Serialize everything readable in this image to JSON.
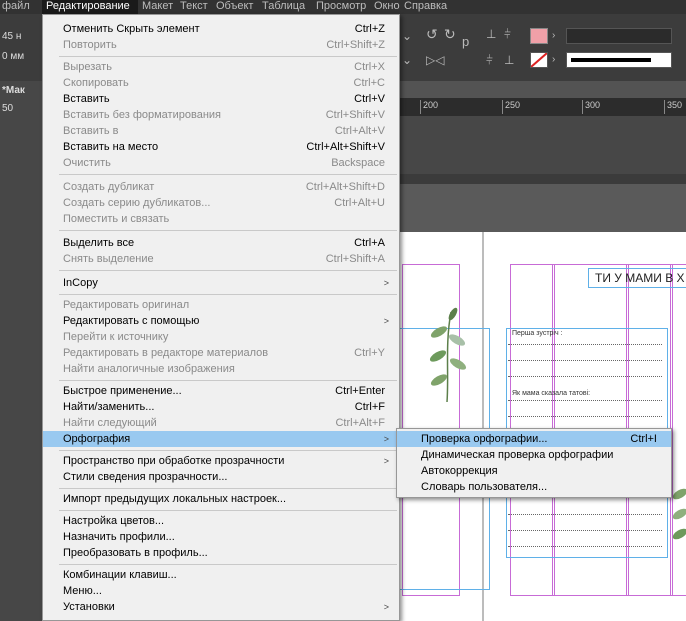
{
  "menubar": {
    "items": [
      "файл",
      "Редактирование",
      "Макет",
      "Текст",
      "Объект",
      "Таблица",
      "Просмотр",
      "Окно",
      "Справка"
    ]
  },
  "leftstrip": {
    "values": [
      "45 н",
      "0 мм",
      "*Мак",
      "50"
    ]
  },
  "ruler": {
    "ticks": [
      "200",
      "250",
      "300",
      "350"
    ]
  },
  "document": {
    "heading": "ТИ У МАМИ В Х",
    "line1": "Перша зустріч :",
    "line2": "Як мама сказала татові:"
  },
  "menu": {
    "items": [
      {
        "label": "Отменить Скрыть элемент",
        "shortcut": "Ctrl+Z"
      },
      {
        "label": "Повторить",
        "shortcut": "Ctrl+Shift+Z"
      },
      {
        "label": "Вырезать",
        "shortcut": "Ctrl+X"
      },
      {
        "label": "Скопировать",
        "shortcut": "Ctrl+C"
      },
      {
        "label": "Вставить",
        "shortcut": "Ctrl+V"
      },
      {
        "label": "Вставить без форматирования",
        "shortcut": "Ctrl+Shift+V"
      },
      {
        "label": "Вставить в",
        "shortcut": "Ctrl+Alt+V"
      },
      {
        "label": "Вставить на место",
        "shortcut": "Ctrl+Alt+Shift+V"
      },
      {
        "label": "Очистить",
        "shortcut": "Backspace"
      },
      {
        "label": "Создать дубликат",
        "shortcut": "Ctrl+Alt+Shift+D"
      },
      {
        "label": "Создать серию дубликатов...",
        "shortcut": "Ctrl+Alt+U"
      },
      {
        "label": "Поместить и связать",
        "shortcut": ""
      },
      {
        "label": "Выделить все",
        "shortcut": "Ctrl+A"
      },
      {
        "label": "Снять выделение",
        "shortcut": "Ctrl+Shift+A"
      },
      {
        "label": "InCopy",
        "shortcut": ""
      },
      {
        "label": "Редактировать оригинал",
        "shortcut": ""
      },
      {
        "label": "Редактировать с помощью",
        "shortcut": ""
      },
      {
        "label": "Перейти к источнику",
        "shortcut": ""
      },
      {
        "label": "Редактировать в редакторе материалов",
        "shortcut": "Ctrl+Y"
      },
      {
        "label": "Найти аналогичные изображения",
        "shortcut": ""
      },
      {
        "label": "Быстрое применение...",
        "shortcut": "Ctrl+Enter"
      },
      {
        "label": "Найти/заменить...",
        "shortcut": "Ctrl+F"
      },
      {
        "label": "Найти следующий",
        "shortcut": "Ctrl+Alt+F"
      },
      {
        "label": "Орфография",
        "shortcut": ""
      },
      {
        "label": "Пространство при обработке прозрачности",
        "shortcut": ""
      },
      {
        "label": "Стили сведения прозрачности...",
        "shortcut": ""
      },
      {
        "label": "Импорт предыдущих локальных настроек...",
        "shortcut": ""
      },
      {
        "label": "Настройка цветов...",
        "shortcut": ""
      },
      {
        "label": "Назначить профили...",
        "shortcut": ""
      },
      {
        "label": "Преобразовать в профиль...",
        "shortcut": ""
      },
      {
        "label": "Комбинации клавиш...",
        "shortcut": ""
      },
      {
        "label": "Меню...",
        "shortcut": ""
      },
      {
        "label": "Установки",
        "shortcut": ""
      }
    ]
  },
  "submenu": {
    "items": [
      {
        "label": "Проверка орфографии...",
        "shortcut": "Ctrl+I"
      },
      {
        "label": "Динамическая проверка орфографии",
        "shortcut": ""
      },
      {
        "label": "Автокоррекция",
        "shortcut": ""
      },
      {
        "label": "Словарь пользователя...",
        "shortcut": ""
      }
    ]
  },
  "colors": {
    "highlight": "#99c9f0",
    "margin_guide": "#c76bd6",
    "column_guide": "#5fb0e8",
    "leaf": "#7fa36a"
  }
}
